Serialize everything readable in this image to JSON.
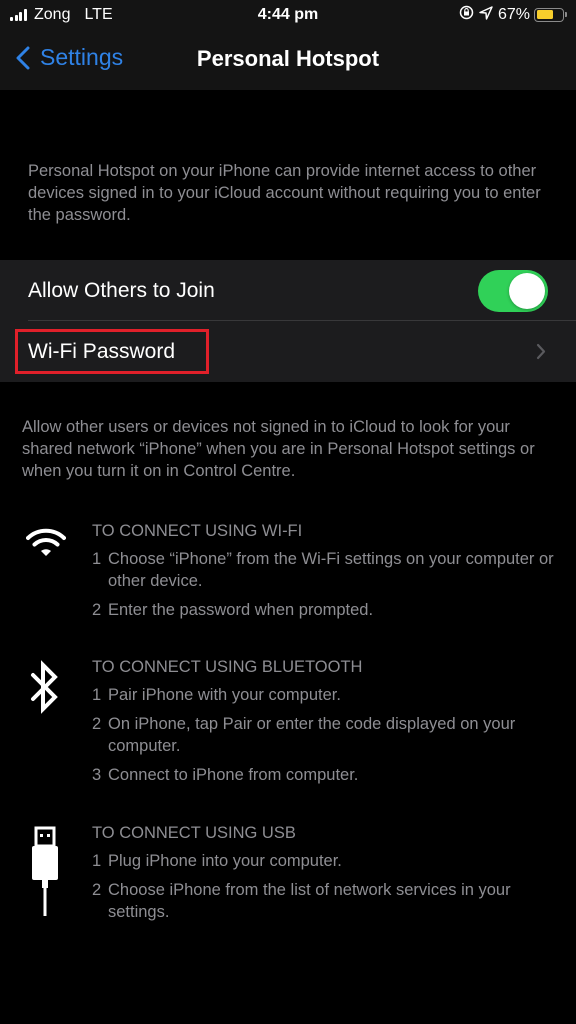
{
  "status_bar": {
    "carrier": "Zong",
    "network": "LTE",
    "time": "4:44 pm",
    "battery_percent_label": "67%",
    "battery_level": 0.67,
    "icons": [
      "signal-icon",
      "orientation-lock-icon",
      "location-icon",
      "battery-icon"
    ]
  },
  "nav": {
    "back_label": "Settings",
    "title": "Personal Hotspot"
  },
  "intro_text": "Personal Hotspot on your iPhone can provide internet access to other devices signed in to your iCloud account without requiring you to enter the password.",
  "settings": {
    "allow_others": {
      "label": "Allow Others to Join",
      "enabled": true
    },
    "wifi_password": {
      "label": "Wi-Fi Password"
    }
  },
  "footer_text": "Allow other users or devices not signed in to iCloud to look for your shared network “iPhone” when you are in Personal Hotspot settings or when you turn it on in Control Centre.",
  "methods": [
    {
      "icon": "wifi-icon",
      "title": "TO CONNECT USING WI-FI",
      "steps": [
        {
          "num": "1",
          "text": "Choose “iPhone” from the Wi-Fi settings on your computer or other device."
        },
        {
          "num": "2",
          "text": "Enter the password when prompted."
        }
      ]
    },
    {
      "icon": "bluetooth-icon",
      "title": "TO CONNECT USING BLUETOOTH",
      "steps": [
        {
          "num": "1",
          "text": "Pair iPhone with your computer."
        },
        {
          "num": "2",
          "text": "On iPhone, tap Pair or enter the code displayed on your computer."
        },
        {
          "num": "3",
          "text": "Connect to iPhone from computer."
        }
      ]
    },
    {
      "icon": "usb-cable-icon",
      "title": "TO CONNECT USING USB",
      "steps": [
        {
          "num": "1",
          "text": "Plug iPhone into your computer."
        },
        {
          "num": "2",
          "text": "Choose iPhone from the list of network services in your settings."
        }
      ]
    }
  ],
  "colors": {
    "accent_blue": "#2f82e6",
    "toggle_on": "#30d158",
    "highlight_red": "#e0202a",
    "battery_yellow": "#f7ce2c"
  }
}
